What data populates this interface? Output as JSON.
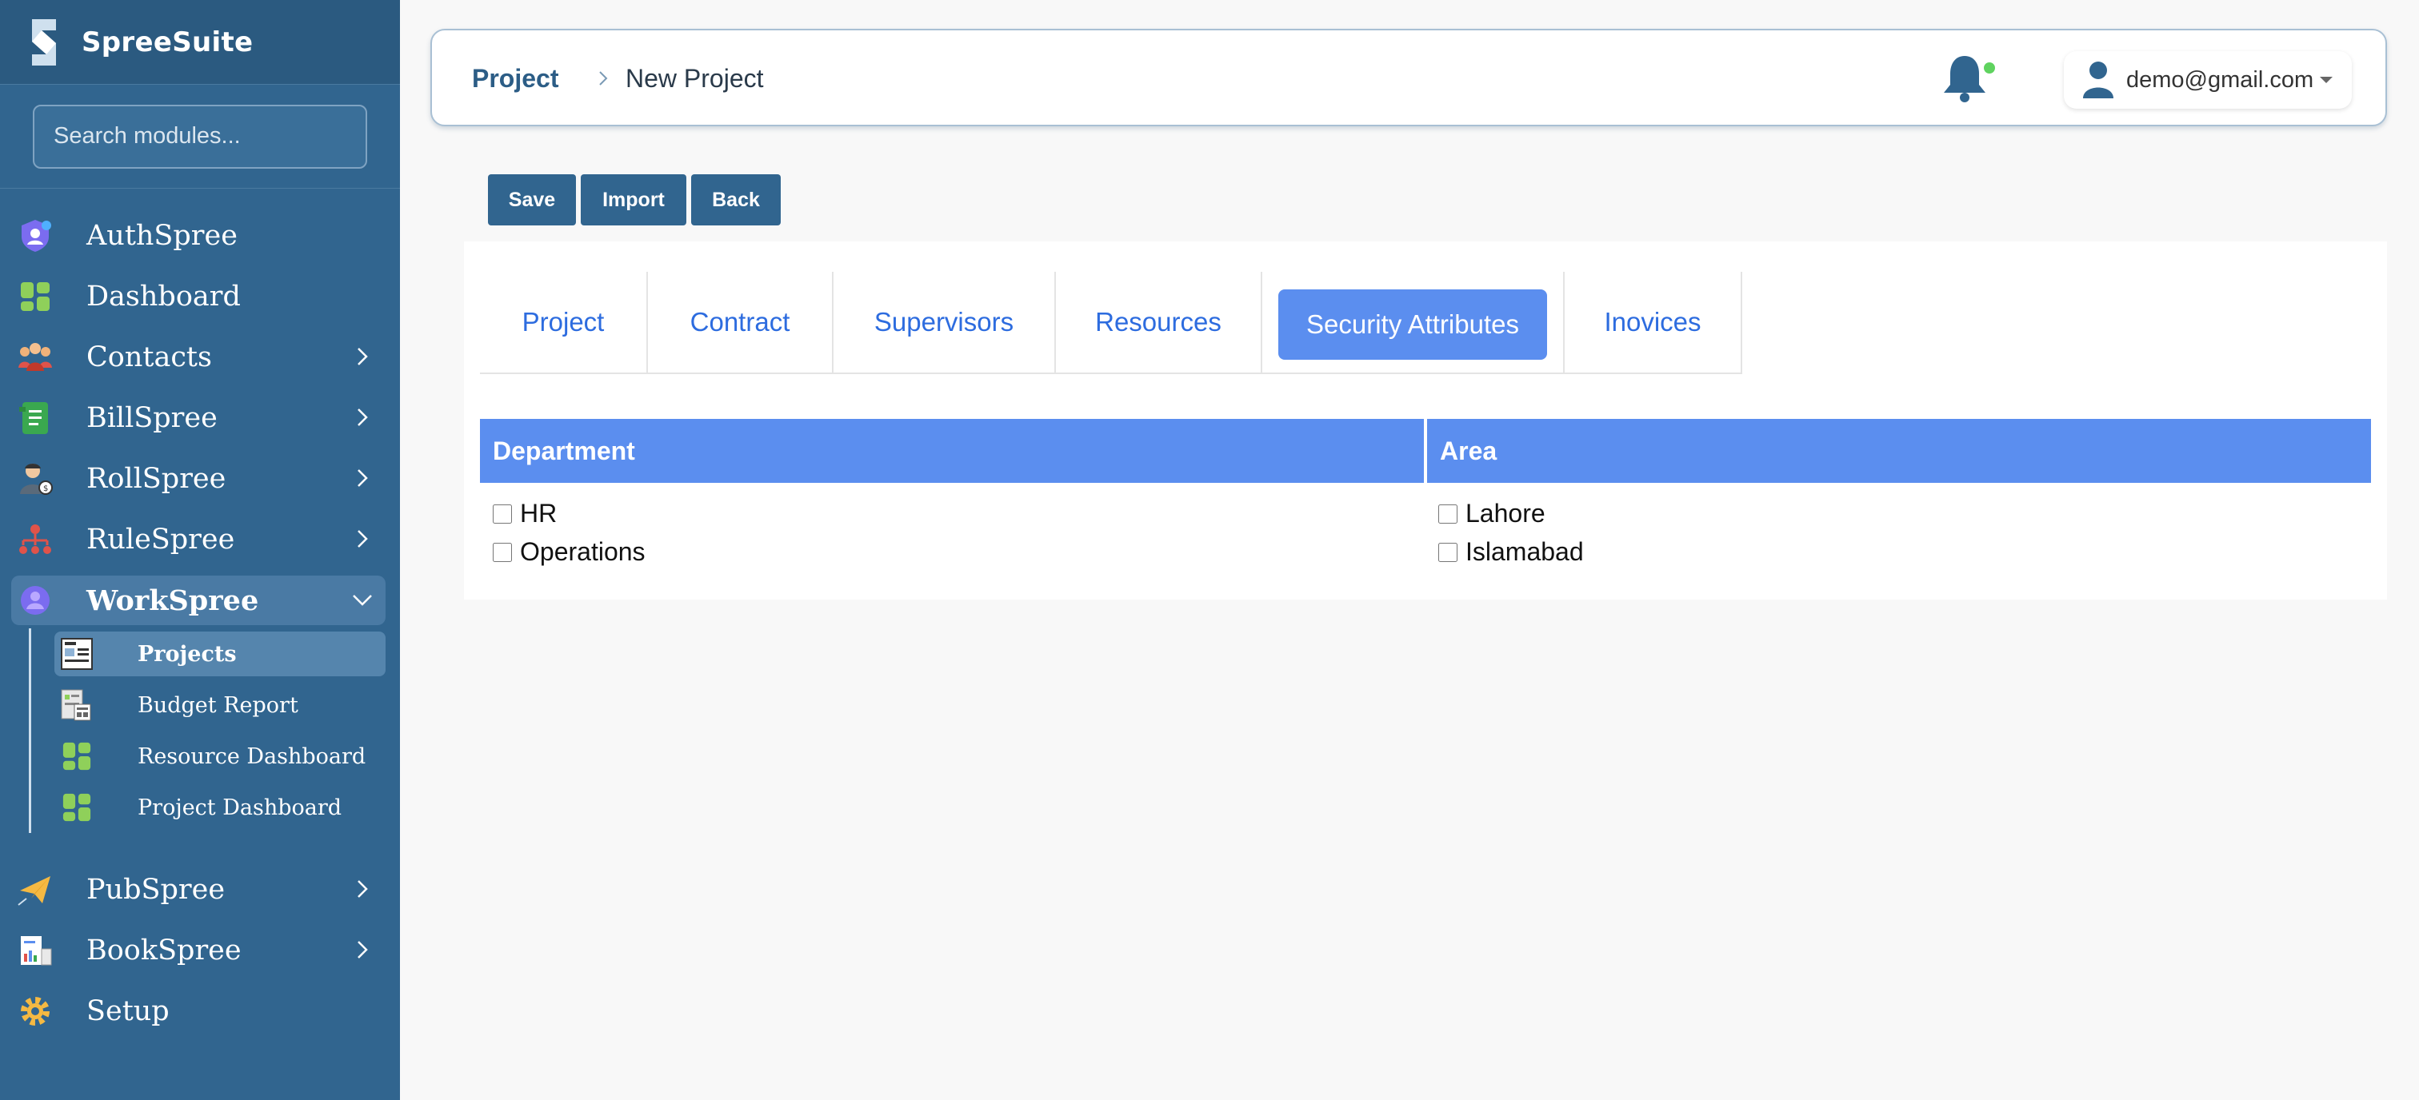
{
  "app": {
    "name": "SpreeSuite"
  },
  "search": {
    "placeholder": "Search modules..."
  },
  "sidebar": {
    "items": [
      {
        "label": "AuthSpree",
        "icon": "shield-user-icon",
        "expandable": false
      },
      {
        "label": "Dashboard",
        "icon": "dashboard-icon",
        "expandable": false
      },
      {
        "label": "Contacts",
        "icon": "contacts-icon",
        "expandable": true
      },
      {
        "label": "BillSpree",
        "icon": "bill-icon",
        "expandable": true
      },
      {
        "label": "RollSpree",
        "icon": "payroll-icon",
        "expandable": true
      },
      {
        "label": "RuleSpree",
        "icon": "hierarchy-icon",
        "expandable": true
      },
      {
        "label": "WorkSpree",
        "icon": "workspree-icon",
        "expandable": true,
        "expanded": true
      },
      {
        "label": "PubSpree",
        "icon": "paper-plane-icon",
        "expandable": true
      },
      {
        "label": "BookSpree",
        "icon": "books-icon",
        "expandable": true
      },
      {
        "label": "Setup",
        "icon": "gear-icon",
        "expandable": false
      }
    ],
    "workspree_children": [
      {
        "label": "Projects",
        "icon": "project-doc-icon",
        "active": true
      },
      {
        "label": "Budget Report",
        "icon": "budget-report-icon"
      },
      {
        "label": "Resource Dashboard",
        "icon": "dashboard-icon"
      },
      {
        "label": "Project Dashboard",
        "icon": "dashboard-icon"
      }
    ]
  },
  "header": {
    "breadcrumb_root": "Project",
    "breadcrumb_current": "New Project",
    "user_email": "demo@gmail.com",
    "notification_status_color": "#5fd35f"
  },
  "toolbar": {
    "save_label": "Save",
    "import_label": "Import",
    "back_label": "Back"
  },
  "tabs": {
    "items": [
      "Project",
      "Contract",
      "Supervisors",
      "Resources",
      "Security Attributes",
      "Inovices"
    ],
    "active": "Security Attributes"
  },
  "security": {
    "department": {
      "header": "Department",
      "options": [
        {
          "label": "HR",
          "checked": false
        },
        {
          "label": "Operations",
          "checked": false
        }
      ]
    },
    "area": {
      "header": "Area",
      "options": [
        {
          "label": "Lahore",
          "checked": false
        },
        {
          "label": "Islamabad",
          "checked": false
        }
      ]
    }
  },
  "colors": {
    "sidebar": "#31658f",
    "accent": "#5b8eef",
    "tab_text": "#2d6cdf",
    "button": "#31658f"
  }
}
